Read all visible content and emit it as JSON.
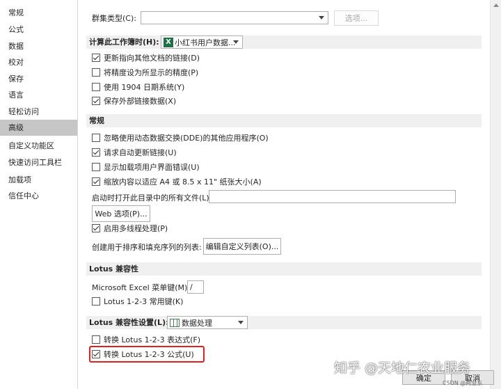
{
  "sidebar": {
    "items": [
      {
        "label": "常规"
      },
      {
        "label": "公式"
      },
      {
        "label": "数据"
      },
      {
        "label": "校对"
      },
      {
        "label": "保存"
      },
      {
        "label": "语言"
      },
      {
        "label": "轻松访问"
      },
      {
        "label": "高级",
        "selected": true
      },
      {
        "label": "自定义功能区"
      },
      {
        "label": "快速访问工具栏"
      },
      {
        "label": "加载项"
      },
      {
        "label": "信任中心"
      }
    ]
  },
  "top": {
    "cluster_label": "群集类型(C):",
    "cluster_value": "",
    "options_button": "选项..."
  },
  "workbook_section": {
    "title": "计算此工作簿时(H):",
    "workbook_value": "小红书用户数据...",
    "items": [
      {
        "label": "更新指向其他文档的链接(D)",
        "checked": true
      },
      {
        "label": "将精度设为所显示的精度(P)",
        "checked": false
      },
      {
        "label": "使用 1904 日期系统(Y)",
        "checked": false
      },
      {
        "label": "保存外部链接数据(X)",
        "checked": true
      }
    ]
  },
  "general_section": {
    "title": "常规",
    "items": [
      {
        "label": "忽略使用动态数据交换(DDE)的其他应用程序(O)",
        "checked": false
      },
      {
        "label": "请求自动更新链接(U)",
        "checked": true
      },
      {
        "label": "显示加载项用户界面错误(U)",
        "checked": false
      },
      {
        "label": "缩放内容以适应 A4 或 8.5 x 11\" 纸张大小(A)",
        "checked": true
      }
    ],
    "startup_label": "启动时打开此目录中的所有文件(L):",
    "startup_value": "",
    "web_options_button": "Web 选项(P)...",
    "multithread_label": "启用多线程处理(P)",
    "multithread_checked": true,
    "custom_list_label": "创建用于排序和填充序列的列表:",
    "custom_list_button": "编辑自定义列表(O)..."
  },
  "lotus_section": {
    "title": "Lotus 兼容性",
    "menu_key_label": "Microsoft Excel 菜单键(M):",
    "menu_key_value": "/",
    "nav_keys_label": "Lotus 1-2-3 常用键(K)",
    "nav_keys_checked": false
  },
  "lotus_settings_section": {
    "title": "Lotus 兼容性设置(L):",
    "sheet_value": "数据处理",
    "items": [
      {
        "label": "转换 Lotus 1-2-3 表达式(F)",
        "checked": false
      },
      {
        "label": "转换 Lotus 1-2-3 公式(U)",
        "checked": true
      }
    ]
  },
  "footer": {
    "ok": "确定",
    "cancel": "取消"
  },
  "watermark": {
    "text": "知乎 @天地仁农业服务",
    "csdn": "CSDN @阿业东"
  },
  "colors": {
    "highlight": "#e02020",
    "selected_sidebar": "#c6c6c6",
    "section_bg": "#f0f0f0"
  }
}
